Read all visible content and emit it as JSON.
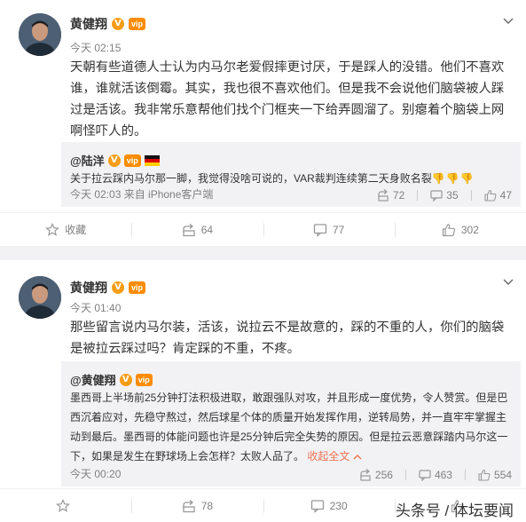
{
  "posts": [
    {
      "username": "黄健翔",
      "verified_badge": "V",
      "level_badge": "vip",
      "time": "今天 02:15",
      "text": "天朝有些道德人士认为内马尔老爱假摔更讨厌，于是踩人的没错。他们不喜欢谁，谁就活该倒霉。其实，我也很不喜欢他们。但是我不会说他们脑袋被人踩过是活该。我非常乐意帮他们找个门框夹一下给弄圆溜了。别瘪着个脑袋上网啊怪吓人的。",
      "quote": {
        "author": "@陆洋",
        "text": "关于拉云踩内马尔那一脚，我觉得没啥可说的，VAR裁判连续第二天身败名裂",
        "emoji": "👎👎👎",
        "meta": "今天 02:03 来自 iPhone客户端",
        "forward_count": "72",
        "comment_count": "35",
        "like_count": "47"
      },
      "actions": {
        "favorite": "收藏",
        "forward": "64",
        "comment": "77",
        "like": "302"
      }
    },
    {
      "username": "黄健翔",
      "verified_badge": "V",
      "level_badge": "vip",
      "time": "今天 01:40",
      "text": "那些留言说内马尔装，活该，说拉云不是故意的，踩的不重的人，你们的脑袋是被拉云踩过吗？肯定踩的不重，不疼。",
      "quote": {
        "author": "@黄健翔",
        "text": "墨西哥上半场前25分钟打法积极进取，敢跟强队对攻，并且形成一度优势，令人赞赏。但是巴西沉着应对，先稳守熬过，然后球星个体的质量开始发挥作用，逆转局势，并一直牢牢掌握主动到最后。墨西哥的体能问题也许是25分钟后完全失势的原因。但是拉云恶意踩踏内马尔这一下，如果是发生在野球场上会怎样？太败人品了。",
        "collapse": "收起全文",
        "meta": "今天 00:20",
        "forward_count": "256",
        "comment_count": "463",
        "like_count": "554"
      },
      "actions": {
        "favorite": "",
        "forward": "78",
        "comment": "230",
        "like": ""
      }
    }
  ],
  "watermark": "头条号 / 体坛要闻",
  "colors": {
    "link": "#eb7350",
    "muted": "#808080",
    "badge_orange": "#f79d16"
  }
}
